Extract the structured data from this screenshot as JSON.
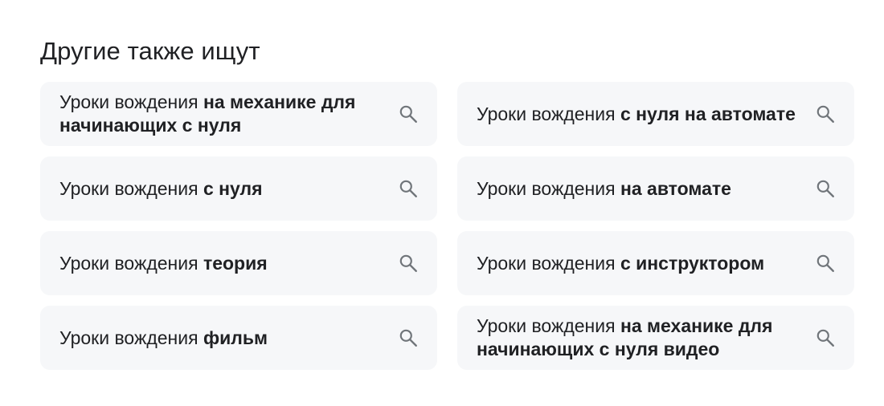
{
  "section": {
    "title": "Другие также ищут"
  },
  "suggestions": [
    {
      "prefix": "Уроки вождения ",
      "bold": "на механике для начинающих с нуля"
    },
    {
      "prefix": "Уроки вождения ",
      "bold": "с нуля на автомате"
    },
    {
      "prefix": "Уроки вождения ",
      "bold": "с нуля"
    },
    {
      "prefix": "Уроки вождения ",
      "bold": "на автомате"
    },
    {
      "prefix": "Уроки вождения ",
      "bold": "теория"
    },
    {
      "prefix": "Уроки вождения ",
      "bold": "с инструктором"
    },
    {
      "prefix": "Уроки вождения ",
      "bold": "фильм"
    },
    {
      "prefix": "Уроки вождения ",
      "bold": "на механике для начинающих с нуля видео"
    }
  ],
  "icons": {
    "suggestion_icon": "search-icon"
  },
  "colors": {
    "chip_background": "#f6f7f9",
    "text": "#202124",
    "icon": "#70757a"
  }
}
